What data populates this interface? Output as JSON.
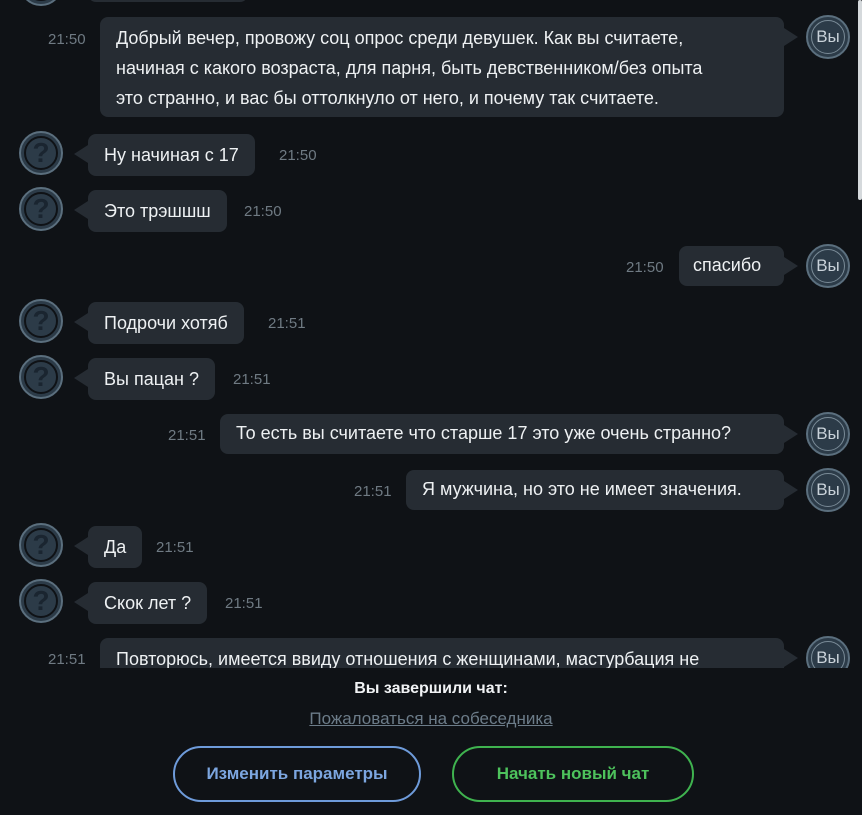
{
  "chat": {
    "stranger_avatar": "?",
    "me_avatar": "Вы",
    "messages": [
      {
        "from": "me",
        "time": "21:50",
        "lines": [
          "Добрый вечер, провожу соц опрос среди девушек. Как вы считаете,",
          "начиная с какого возраста, для парня, быть девственником/без опыта",
          "это странно, и вас бы оттолкнуло от него, и почему так считаете."
        ]
      },
      {
        "from": "stranger",
        "time": "21:50",
        "text": "Ну начиная с 17"
      },
      {
        "from": "stranger",
        "time": "21:50",
        "text": "Это трэшшш"
      },
      {
        "from": "me",
        "time": "21:50",
        "text": "спасибо"
      },
      {
        "from": "stranger",
        "time": "21:51",
        "text": "Подрочи хотяб"
      },
      {
        "from": "stranger",
        "time": "21:51",
        "text": "Вы пацан ?"
      },
      {
        "from": "me",
        "time": "21:51",
        "text": "То есть вы считаете что старше 17 это уже очень странно?"
      },
      {
        "from": "me",
        "time": "21:51",
        "text": "Я мужчина, но это не имеет значения."
      },
      {
        "from": "stranger",
        "time": "21:51",
        "text": "Да"
      },
      {
        "from": "stranger",
        "time": "21:51",
        "text": "Скок лет ?"
      },
      {
        "from": "me",
        "time": "21:51",
        "text": "Повторюсь, имеется ввиду отношения с женщинами, мастурбация не"
      }
    ]
  },
  "footer": {
    "ended_text": "Вы завершили чат:",
    "report_link": "Пожаловаться на собеседника",
    "change_params_button": "Изменить параметры",
    "new_chat_button": "Начать новый чат"
  },
  "colors": {
    "background": "#0f1216",
    "bubble": "#262c33",
    "params_button": "#6e9bda",
    "new_chat_button": "#3fb34f"
  }
}
